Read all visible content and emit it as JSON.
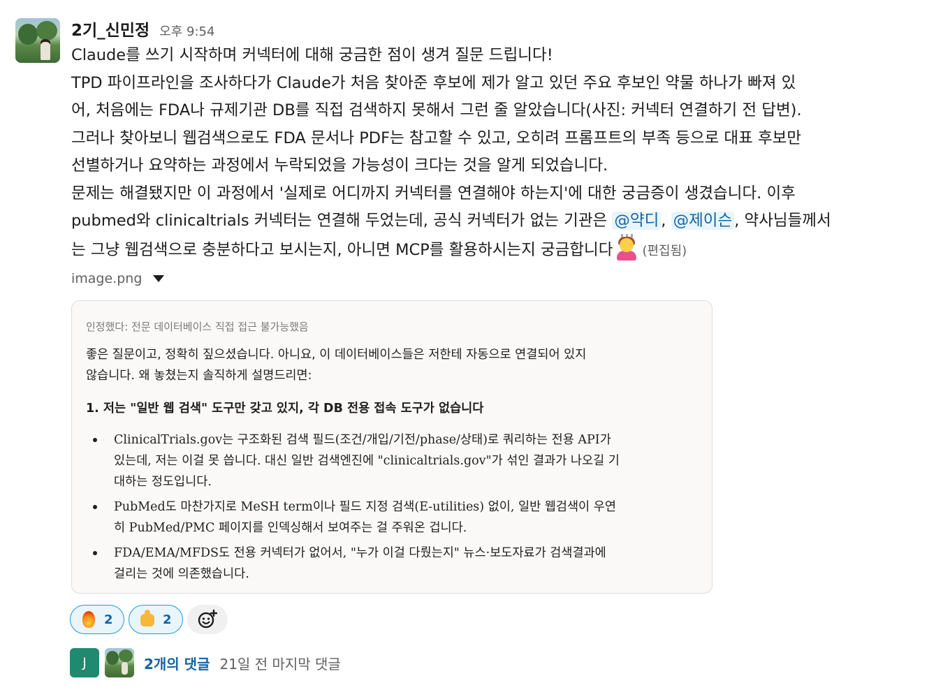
{
  "message": {
    "sender": "2기_신민정",
    "timestamp": "오후 9:54",
    "lines": {
      "l1": "Claude를 쓰기 시작하며 커넥터에 대해 궁금한 점이 생겨 질문 드립니다!",
      "l2": "TPD 파이프라인을 조사하다가 Claude가 처음 찾아준 후보에 제가 알고 있던 주요 후보인 약물 하나가 빠져 있",
      "l3": "어, 처음에는 FDA나 규제기관 DB를 직접 검색하지 못해서 그런 줄 알았습니다(사진: 커넥터 연결하기 전 답변).",
      "l4": "그러나 찾아보니 웹검색으로도 FDA 문서나 PDF는 참고할 수 있고, 오히려 프롬프트의 부족 등으로 대표 후보만",
      "l5": "선별하거나 요약하는 과정에서 누락되었을 가능성이 크다는 것을 알게 되었습니다.",
      "l6": "문제는 해결됐지만 이 과정에서 '실제로 어디까지 커넥터를 연결해야 하는지'에 대한 궁금증이 생겼습니다. 이후",
      "l7_a": "pubmed와 clinicaltrials 커넥터는 연결해 두었는데, 공식 커넥터가 없는 기관은 ",
      "mention1": "@약디",
      "l7_sep": ", ",
      "mention2": "@제이슨",
      "l7_b": ", 약사님들께서",
      "l8": "는 그냥 웹검색으로 충분하다고 보시는지, 아니면 MCP를 활용하시는지 궁금합니다",
      "edited": "(편집됨)"
    },
    "emoji_icon": "person-bowing-emoji"
  },
  "attachment": {
    "file_name": "image.png",
    "image": {
      "note": "인정했다: 전문 데이터베이스 직접 접근 불가능했음",
      "para1": "좋은 질문이고, 정확히 짚으셨습니다. 아니요, 이 데이터베이스들은 저한테 자동으로 연결되어 있지",
      "para2": "않습니다. 왜 놓쳤는지 솔직하게 설명드리면:",
      "heading": "1. 저는 \"일반 웹 검색\" 도구만 갖고 있지, 각 DB 전용 접속 도구가 없습니다",
      "bullets": [
        {
          "l1": "ClinicalTrials.gov는 구조화된 검색 필드(조건/개입/기전/phase/상태)로 쿼리하는 전용 API가",
          "l2": "있는데, 저는 이걸 못 씁니다. 대신 일반 검색엔진에 \"clinicaltrials.gov\"가 섞인 결과가 나오길 기",
          "l3": "대하는 정도입니다."
        },
        {
          "l1": "PubMed도 마찬가지로 MeSH term이나 필드 지정 검색(E-utilities) 없이, 일반 웹검색이 우연",
          "l2": "히 PubMed/PMC 페이지를 인덱싱해서 보여주는 걸 주워온 겁니다."
        },
        {
          "l1": "FDA/EMA/MFDS도 전용 커넥터가 없어서, \"누가 이걸 다뤘는지\" 뉴스·보도자료가 검색결과에",
          "l2": "걸리는 것에 의존했습니다."
        }
      ]
    }
  },
  "reactions": [
    {
      "icon": "fire-emoji",
      "count": "2"
    },
    {
      "icon": "thumbs-up-emoji",
      "count": "2"
    }
  ],
  "thread": {
    "avatar_initial": "J",
    "reply_count": "2개의 댓글",
    "last_reply": "21일 전 마지막 댓글"
  },
  "colors": {
    "link": "#1264a3",
    "mention_bg": "#e8f5fa",
    "reaction_border": "#1d9bd1",
    "thread_avatar": "#1f8a70"
  }
}
